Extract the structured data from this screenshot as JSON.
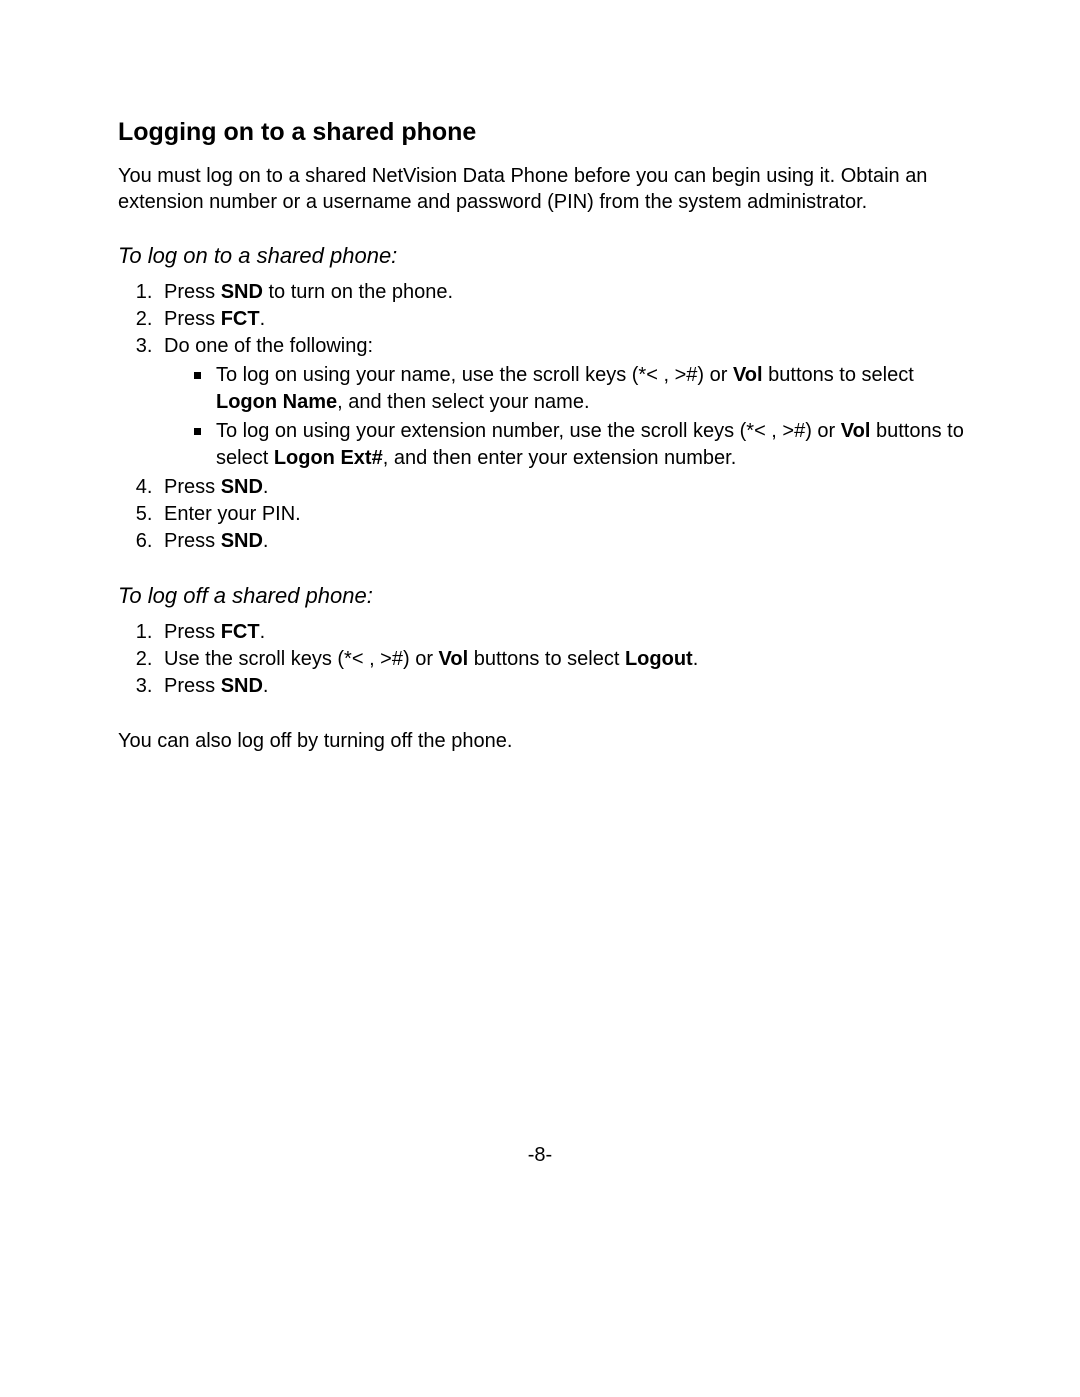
{
  "title": "Logging on to a shared phone",
  "intro": "You must log on to a shared NetVision Data Phone before you can begin using it. Obtain an extension number or a username and password (PIN) from the system administrator.",
  "section1": {
    "heading": "To log on to a shared phone:",
    "step1": {
      "prefix": "Press ",
      "bold": "SND",
      "suffix": " to turn on the phone."
    },
    "step2": {
      "prefix": "Press ",
      "bold": "FCT",
      "suffix": "."
    },
    "step3": {
      "text": "Do one of the following:",
      "bullet1": {
        "p1": "To log on using your name, use the scroll keys (*< , >#) or ",
        "b1": "Vol",
        "p2": " buttons to select ",
        "b2": "Logon Name",
        "p3": ", and then select your name."
      },
      "bullet2": {
        "p1": "To log on using your extension number, use the scroll keys (*< , >#) or ",
        "b1": "Vol",
        "p2": " buttons to select ",
        "b2": "Logon Ext#",
        "p3": ", and then enter your extension number."
      }
    },
    "step4": {
      "prefix": "Press ",
      "bold": "SND",
      "suffix": "."
    },
    "step5": {
      "text": "Enter your PIN."
    },
    "step6": {
      "prefix": "Press ",
      "bold": "SND",
      "suffix": "."
    }
  },
  "section2": {
    "heading": "To log off a shared phone:",
    "step1": {
      "prefix": "Press ",
      "bold": "FCT",
      "suffix": "."
    },
    "step2": {
      "p1": "Use the scroll keys (*< , >#) or ",
      "b1": "Vol",
      "p2": " buttons to select ",
      "b2": "Logout",
      "p3": "."
    },
    "step3": {
      "prefix": "Press ",
      "bold": "SND",
      "suffix": "."
    }
  },
  "closing": "You can also log off by turning off the phone.",
  "page_number": "-8-"
}
